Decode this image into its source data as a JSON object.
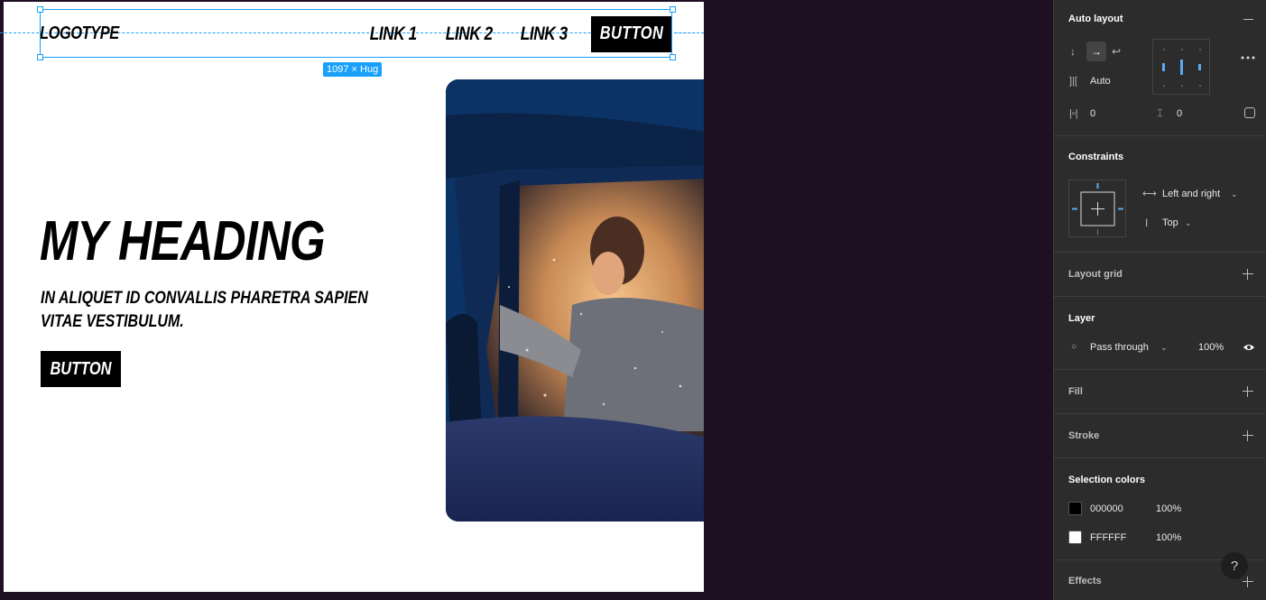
{
  "canvas": {
    "nav": {
      "logo": "LOGOTYPE",
      "links": [
        "LINK 1",
        "LINK 2",
        "LINK 3"
      ],
      "button": "BUTTON"
    },
    "selection_badge": "1097 × Hug",
    "hero": {
      "heading": "MY HEADING",
      "subheading": "IN ALIQUET ID CONVALLIS PHARETRA SAPIEN VITAE VESTIBULUM.",
      "button": "BUTTON",
      "image_icon": "photo-woman-in-car"
    }
  },
  "panel": {
    "auto_layout": {
      "title": "Auto layout",
      "spacing_value": "Auto",
      "padding_horizontal": "0",
      "padding_vertical": "0"
    },
    "constraints": {
      "title": "Constraints",
      "horizontal": "Left and right",
      "vertical": "Top"
    },
    "layout_grid": {
      "title": "Layout grid"
    },
    "layer": {
      "title": "Layer",
      "blend_mode": "Pass through",
      "opacity": "100%"
    },
    "fill": {
      "title": "Fill"
    },
    "stroke": {
      "title": "Stroke"
    },
    "selection_colors": {
      "title": "Selection colors",
      "colors": [
        {
          "hex": "000000",
          "opacity": "100%",
          "swatch": "#000000"
        },
        {
          "hex": "FFFFFF",
          "opacity": "100%",
          "swatch": "#FFFFFF"
        }
      ]
    },
    "effects": {
      "title": "Effects"
    },
    "help": "?"
  },
  "colors": {
    "canvas_bg": "#1e0f23",
    "panel_bg": "#2c2c2c",
    "selection_blue": "#18a0fb"
  }
}
